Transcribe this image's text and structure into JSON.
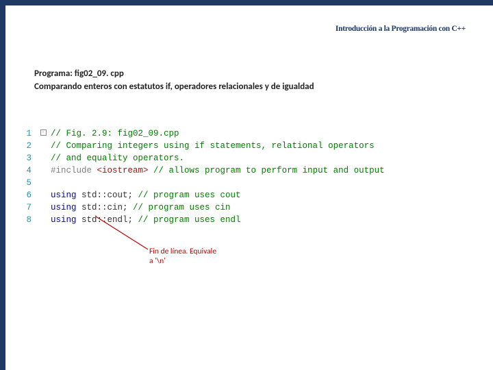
{
  "header": {
    "title": "Introducción a la Programación con C++"
  },
  "program": {
    "line1": "Programa: fig02_09. cpp",
    "line2": "Comparando enteros con estatutos if, operadores relacionales y de igualdad"
  },
  "code": {
    "line1_no": "1",
    "line1_fold": "-",
    "line1_a": "// Fig. 2.9: fig02_09.cpp",
    "line2_no": "2",
    "line2_a": "// Comparing integers using if statements, relational operators",
    "line3_no": "3",
    "line3_a": "// and equality operators.",
    "line4_no": "4",
    "line4_pp": "#include ",
    "line4_inc": "<iostream>",
    "line4_c": " // allows program to perform input and output",
    "line5_no": "5",
    "line6_no": "6",
    "line6_kw": "using",
    "line6_mid": " std::cout; ",
    "line6_c": "// program uses cout",
    "line7_no": "7",
    "line7_kw": "using",
    "line7_mid": " std::cin; ",
    "line7_c": "// program uses cin",
    "line8_no": "8",
    "line8_kw": "using",
    "line8_mid": " std::endl; ",
    "line8_c": "// program uses endl"
  },
  "annotation": {
    "line1": "Fin de línea. Equivale",
    "line2": "a '\\n'"
  }
}
